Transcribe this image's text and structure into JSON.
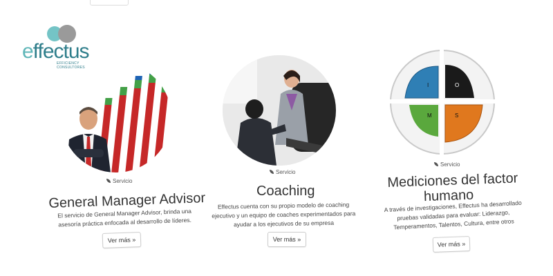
{
  "brand": {
    "name": "ffectus",
    "initial": "e",
    "tagline": "EFFICIENCY CONSULTORES"
  },
  "cards": [
    {
      "badge": "Servicio",
      "title": "General Manager Advisor",
      "desc": [
        "El servicio de General Manager Advisor, brinda una",
        "asesoría práctica enfocada al desarrollo de líderes."
      ],
      "button": "Ver más »"
    },
    {
      "badge": "Servicio",
      "title": "Coaching",
      "desc": [
        "Effectus cuenta con su propio modelo de coaching",
        "ejecutivo y un equipo de coaches experimentados para",
        "ayudar a los ejecutivos de su empresa"
      ],
      "button": "Ver más »"
    },
    {
      "badge": "Servicio",
      "title_lines": [
        "Mediciones del factor",
        "humano"
      ],
      "desc": [
        "A través de investigaciones, Effectus ha desarrollado",
        "pruebas validadas para evaluar: Liderazgo,",
        "Temperamentos, Talentos, Cultura, entre otros"
      ],
      "button": "Ver más »",
      "quadrants": [
        "I",
        "O",
        "M",
        "S"
      ]
    }
  ],
  "colors": {
    "teal": "#5fb6b8",
    "dark_teal": "#2f7e8b",
    "blue": "#2f7fb5",
    "black": "#1a1a1a",
    "green": "#5aa83d",
    "orange": "#e0781e"
  }
}
